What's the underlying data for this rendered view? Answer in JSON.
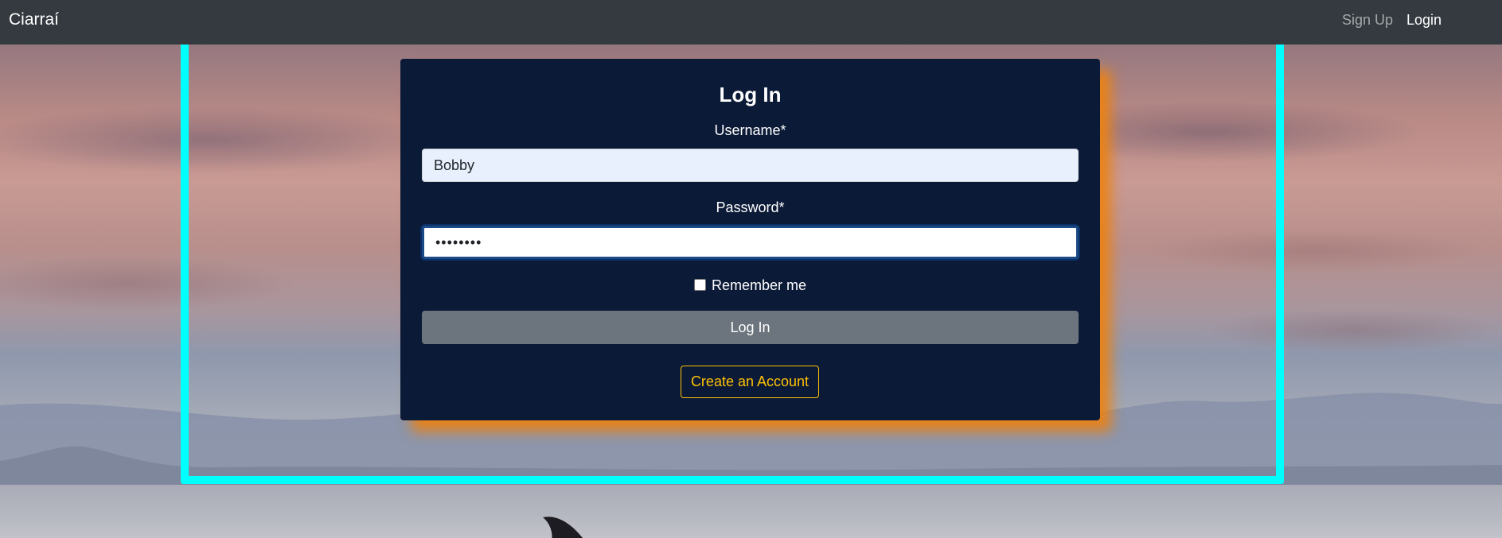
{
  "navbar": {
    "brand": "Ciarraí",
    "signup_label": "Sign Up",
    "login_label": "Login"
  },
  "login_form": {
    "title": "Log In",
    "username_label": "Username*",
    "username_value": "Bobby",
    "password_label": "Password*",
    "password_value_masked": "••••••••",
    "remember_label": "Remember me",
    "remember_checked": false,
    "submit_label": "Log In",
    "create_account_label": "Create an Account"
  },
  "colors": {
    "navbar_bg": "#343a40",
    "card_bg": "#0b1a36",
    "card_shadow": "#eb8214",
    "submit_bg": "#6c757d",
    "create_account_accent": "#ffc107",
    "highlight_frame": "#00ffff"
  },
  "icons": {
    "remember_checkbox": "checkbox-icon"
  }
}
